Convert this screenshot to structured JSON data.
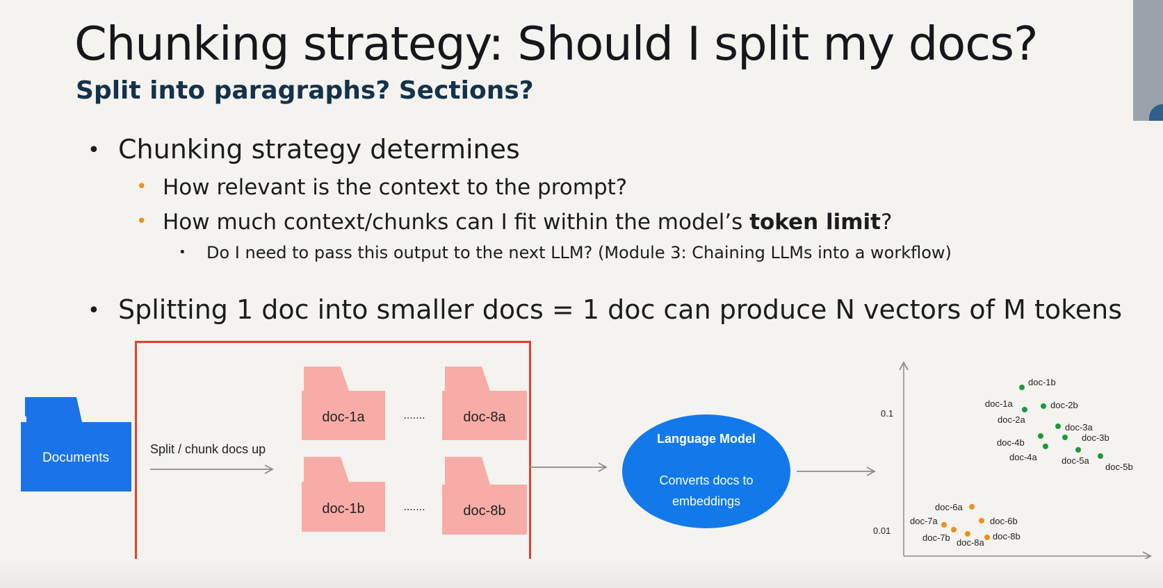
{
  "slide": {
    "title": "Chunking strategy: Should I split my docs?",
    "subtitle": "Split into paragraphs? Sections?"
  },
  "bullets": {
    "b1": "Chunking strategy determines",
    "b1_sub1": "How relevant is the context to the prompt?",
    "b1_sub2_pre": "How much context/chunks can I fit within the model’s ",
    "b1_sub2_bold": "token limit",
    "b1_sub2_post": "?",
    "b1_sub2_sub1": "Do I need to pass this output to the next LLM? (Module 3: Chaining LLMs into a workflow)",
    "b2": "Splitting 1 doc into smaller docs = 1 doc can produce N vectors of M tokens"
  },
  "diagram": {
    "documents_label": "Documents",
    "split_label": "Split / chunk docs up",
    "chunks": [
      "doc-1a",
      "doc-8a",
      "doc-1b",
      "doc-8b"
    ],
    "ellipsis": ".......",
    "model_title": "Language Model",
    "model_line1": "Converts docs to",
    "model_line2": "embeddings",
    "colors": {
      "folder_blue": "#1a73e8",
      "folder_pink": "#f8aca7",
      "model_blue": "#1279ea",
      "green": "#1a9a3a",
      "orange": "#ef8f1e",
      "red_box": "#e0412f"
    }
  },
  "chart_data": {
    "type": "scatter",
    "y_tick_labels": [
      "0.1",
      "0.01"
    ],
    "series": [
      {
        "color": "#1a9a3a",
        "points": [
          "doc-1b",
          "doc-1a",
          "doc-2b",
          "doc-2a",
          "doc-3a",
          "doc-3b",
          "doc-4b",
          "doc-4a",
          "doc-5a",
          "doc-5b"
        ]
      },
      {
        "color": "#ef8f1e",
        "points": [
          "doc-6a",
          "doc-6b",
          "doc-7a",
          "doc-7b",
          "doc-8a",
          "doc-8b"
        ]
      }
    ]
  }
}
